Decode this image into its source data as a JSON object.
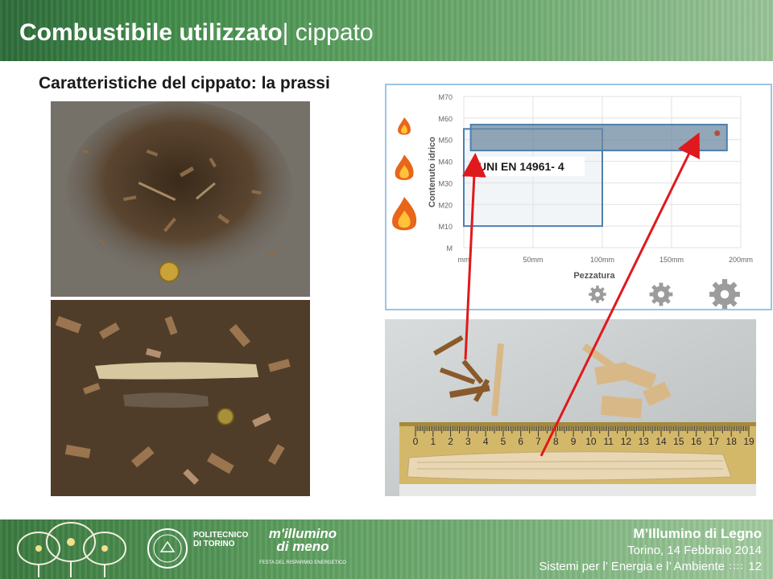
{
  "header": {
    "title_bold": "Combustibile utilizzato",
    "title_regular": "| cippato"
  },
  "subtitle": "Caratteristiche del cippato: la prassi",
  "chart_data": {
    "type": "other",
    "y_axis": {
      "label": "Contenuto idrico",
      "ticks": [
        "M70",
        "M60",
        "M50",
        "M40",
        "M30",
        "M20",
        "M10",
        "M"
      ]
    },
    "x_axis": {
      "label": "Pezzatura",
      "ticks": [
        "mm",
        "50mm",
        "100mm",
        "150mm",
        "200mm"
      ]
    },
    "standard_label": "UNI EN 14961- 4",
    "standard_region": {
      "x_range_mm": [
        0,
        100
      ],
      "y_range": [
        "M10",
        "M55"
      ]
    },
    "observed_region": {
      "x_range_mm": [
        5,
        190
      ],
      "y_range": [
        "M45",
        "M57"
      ]
    },
    "observed_point": {
      "x_mm": 183,
      "moisture": "M53"
    },
    "icons_left": [
      "flame-small-icon",
      "flame-medium-icon",
      "flame-large-icon"
    ],
    "icons_bottom": [
      "gear-small-icon",
      "gear-medium-icon",
      "gear-large-icon"
    ],
    "colors": {
      "standard_region": "#4d7fae",
      "observed_region": "#6e8aa0",
      "arrow": "#e0191d",
      "point": "#b05040"
    }
  },
  "ruler": {
    "numbers": [
      "0",
      "1",
      "2",
      "3",
      "4",
      "5",
      "6",
      "7",
      "8",
      "9",
      "10",
      "11",
      "12",
      "13",
      "14",
      "15",
      "16",
      "17",
      "18",
      "19"
    ]
  },
  "footer": {
    "event": "M’Illumino di Legno",
    "date": "Torino, 14 Febbraio 2014",
    "series": "Sistemi per l’ Energia e l’ Ambiente",
    "page": "12",
    "polito_line1": "POLITECNICO",
    "polito_line2": "DI TORINO",
    "logo_line1": "m'illumino",
    "logo_line2": "di meno",
    "logo_tagline": "FESTA DEL RISPARMIO ENERGETICO"
  }
}
